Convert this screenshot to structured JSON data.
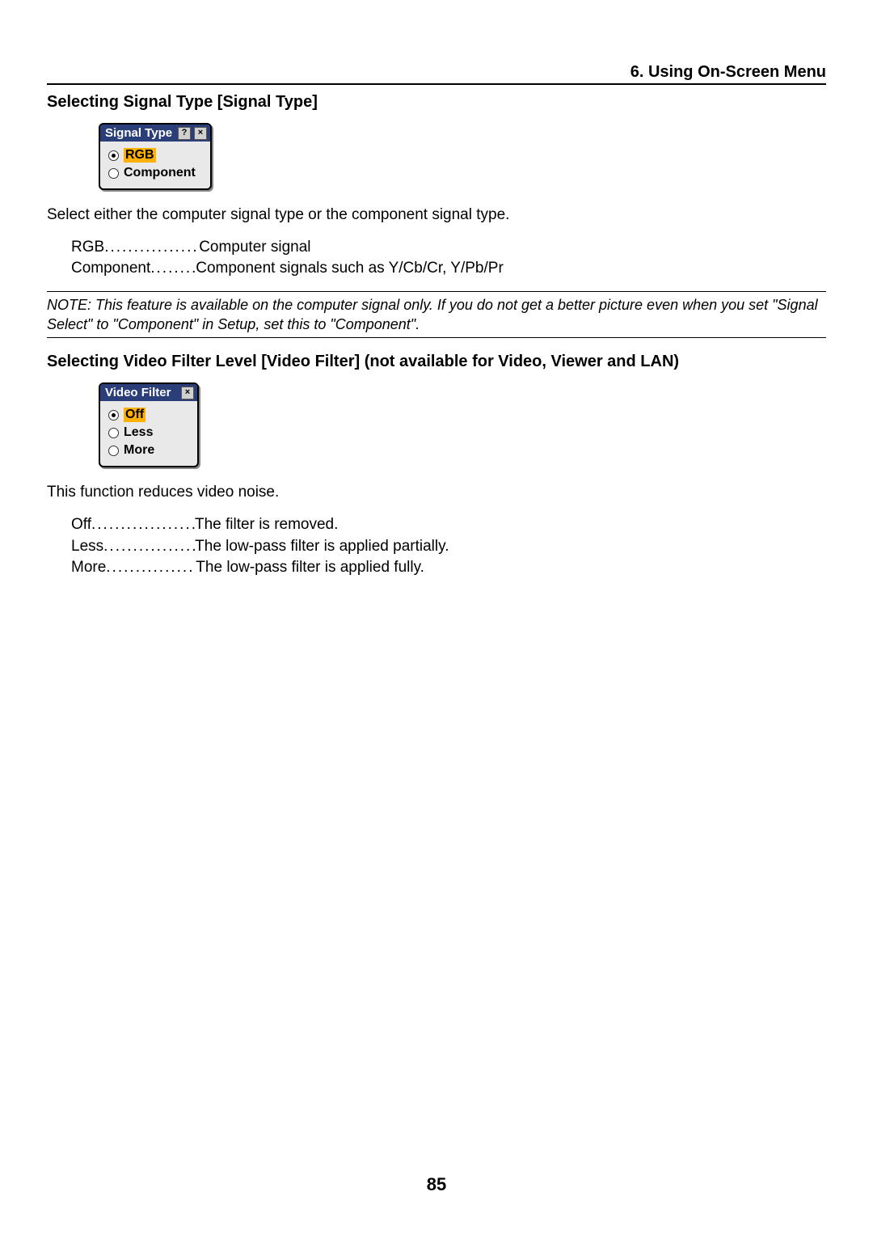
{
  "chapter_header": "6. Using On-Screen Menu",
  "section1": {
    "heading": "Selecting Signal Type [Signal Type]",
    "dialog": {
      "title": "Signal Type",
      "help_glyph": "?",
      "close_glyph": "×",
      "options": [
        {
          "label": "RGB",
          "selected": true
        },
        {
          "label": "Component",
          "selected": false
        }
      ]
    },
    "intro": "Select either the computer signal type or the component signal type.",
    "defs": [
      {
        "term": "RGB",
        "desc": "Computer signal"
      },
      {
        "term": "Component",
        "desc": "Component signals such as Y/Cb/Cr, Y/Pb/Pr"
      }
    ],
    "note": "NOTE: This feature is available on the computer signal only. If you do not get a better picture even when you set \"Signal Select\" to \"Component\" in Setup, set this to \"Component\"."
  },
  "section2": {
    "heading": "Selecting Video Filter Level [Video Filter] (not available for Video, Viewer and LAN)",
    "dialog": {
      "title": "Video Filter",
      "close_glyph": "×",
      "options": [
        {
          "label": "Off",
          "selected": true
        },
        {
          "label": "Less",
          "selected": false
        },
        {
          "label": "More",
          "selected": false
        }
      ]
    },
    "intro": "This function reduces video noise.",
    "defs": [
      {
        "term": "Off",
        "desc": "The filter is removed."
      },
      {
        "term": "Less",
        "desc": "The low-pass filter is applied partially."
      },
      {
        "term": "More",
        "desc": "The low-pass filter is applied fully."
      }
    ]
  },
  "page_number": "85"
}
